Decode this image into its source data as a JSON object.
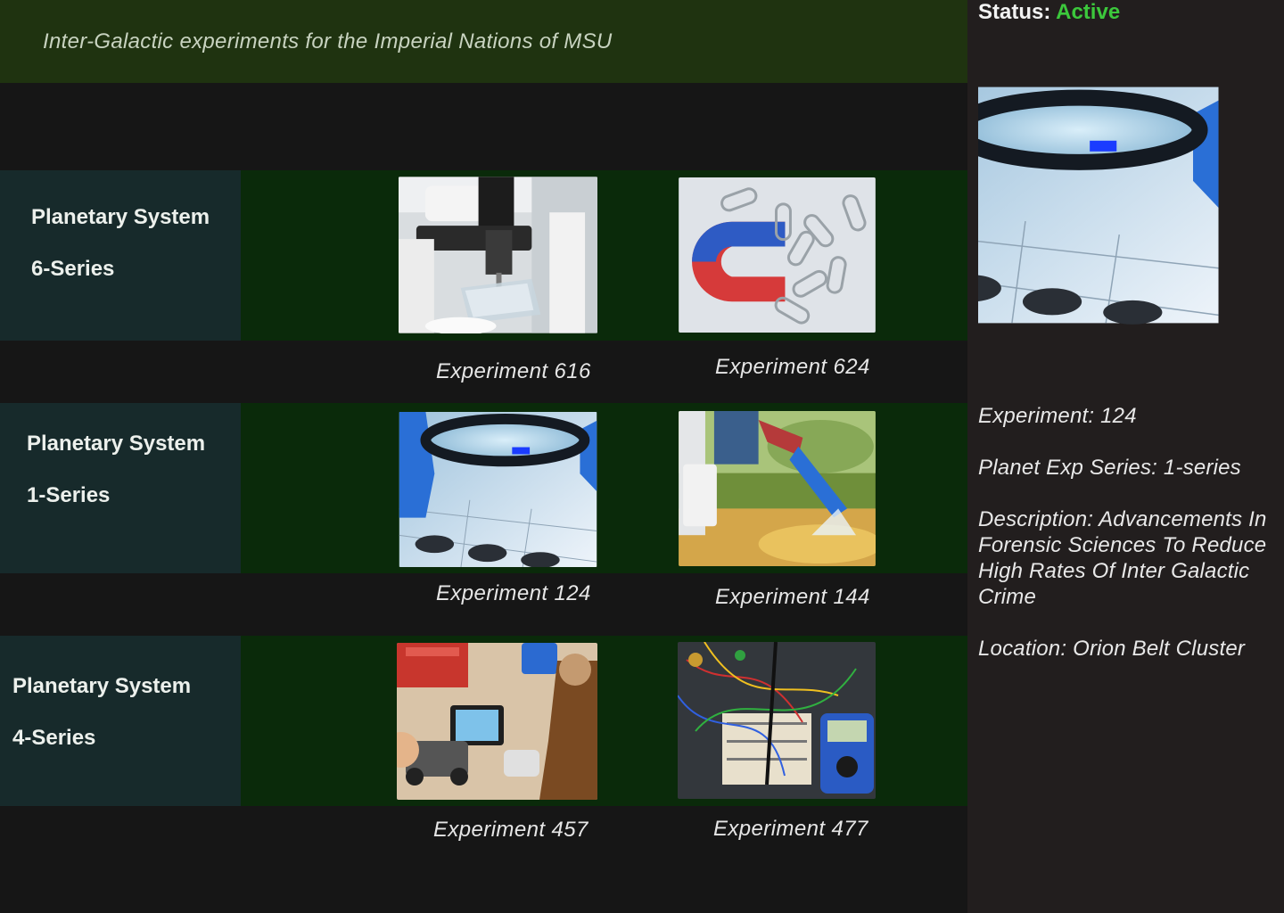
{
  "header": {
    "subtitle": "Inter-Galactic experiments for the Imperial Nations of MSU"
  },
  "systems": [
    {
      "title": "Planetary System",
      "series": "6-Series",
      "experiments": [
        {
          "caption": "Experiment 616",
          "image": "microscope-photo"
        },
        {
          "caption": "Experiment 624",
          "image": "magnet-paperclips-photo"
        }
      ]
    },
    {
      "title": "Planetary System",
      "series": "1-Series",
      "experiments": [
        {
          "caption": "Experiment 124",
          "image": "magnifier-fingerprint-photo"
        },
        {
          "caption": "Experiment 144",
          "image": "water-sampling-photo"
        }
      ]
    },
    {
      "title": "Planetary System",
      "series": "4-Series",
      "experiments": [
        {
          "caption": "Experiment 457",
          "image": "robotics-class-photo"
        },
        {
          "caption": "Experiment 477",
          "image": "electronics-breadboard-photo"
        }
      ]
    }
  ],
  "panel": {
    "status_label": "Status:",
    "status_value": "Active",
    "image": "magnifier-fingerprint-photo",
    "experiment": "Experiment: 124",
    "series": "Planet Exp Series: 1-series",
    "description": "Description: Advancements In Forensic Sciences To Reduce High Rates Of Inter Galactic Crime",
    "location": "Location: Orion Belt Cluster"
  },
  "colors": {
    "header_bg": "#1f3310",
    "row_bg": "#0a2a0a",
    "label_bg": "#172a2b",
    "panel_bg": "#221e1e",
    "status_active": "#3cc83c"
  }
}
